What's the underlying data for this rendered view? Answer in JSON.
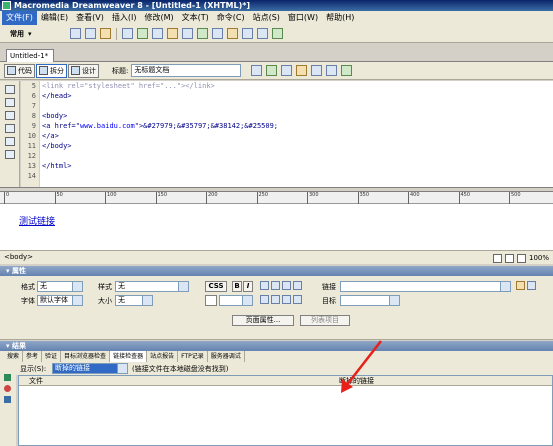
{
  "window": {
    "title": "Macromedia Dreamweaver 8 - [Untitled-1 (XHTML)*]"
  },
  "menu": [
    "文件(F)",
    "编辑(E)",
    "查看(V)",
    "插入(I)",
    "修改(M)",
    "文本(T)",
    "命令(C)",
    "站点(S)",
    "窗口(W)",
    "帮助(H)"
  ],
  "insert_toolbar": {
    "category": "常用"
  },
  "doc_tab": "Untitled-1*",
  "view_buttons": {
    "code": "代码",
    "split": "拆分",
    "design": "设计"
  },
  "doc_title": {
    "label": "标题:",
    "value": "无标题文档"
  },
  "code": {
    "line_numbers": [
      "5",
      "6",
      "7",
      "8",
      "9",
      "10",
      "11",
      "12",
      "13",
      "14"
    ],
    "line5": "<link rel=\"stylesheet\" href=\"...\"></link>",
    "line6": "</head>",
    "line8": "<body>",
    "line9_tag_open": "<a href=\"",
    "line9_href": "www.baidu.com",
    "line9_entities": "\">&#27979;&#35797;&#38142;&#25509;",
    "line10": "</a>",
    "line11": "</body>",
    "line13": "</html>"
  },
  "design_view": {
    "link_text": "测试链接"
  },
  "status_bar": {
    "tag": "<body>",
    "zoom": "100%"
  },
  "properties": {
    "header": "属性",
    "format_label": "格式",
    "format_value": "无",
    "style_label": "样式",
    "style_value": "无",
    "css_button": "CSS",
    "bold_button": "B",
    "italic_button": "I",
    "link_label": "链接",
    "font_label": "字体",
    "font_value": "默认字体",
    "size_label": "大小",
    "size_value": "无",
    "target_label": "目标",
    "page_props_button": "页面属性...",
    "list_item_button": "列表项目"
  },
  "results": {
    "header": "结果",
    "tabs": [
      "搜索",
      "参考",
      "验证",
      "目标浏览器检查",
      "链接检查器",
      "站点报告",
      "FTP记录",
      "服务器调试"
    ],
    "active_tab_index": 4,
    "show_label": "显示(S):",
    "show_value": "断掉的链接",
    "show_hint": "(链接文件在本地磁盘没有找到)",
    "columns": [
      "文件",
      "断掉的链接"
    ]
  }
}
